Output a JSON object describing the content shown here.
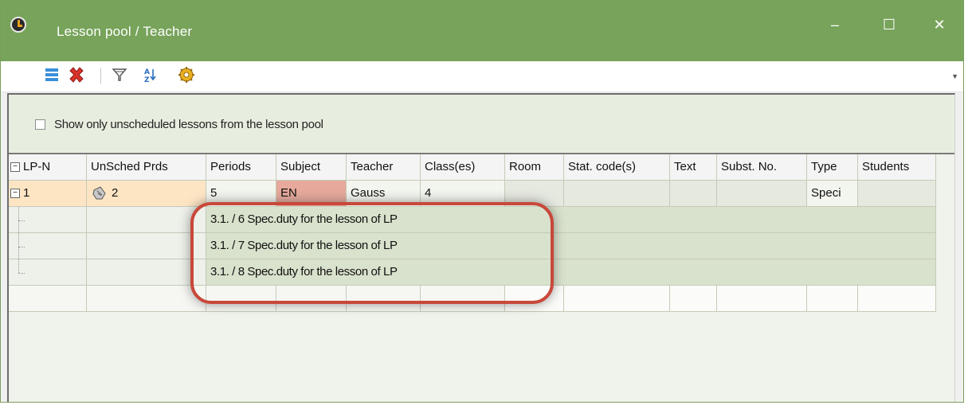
{
  "window": {
    "title": "Lesson pool / Teacher",
    "controls": {
      "minimize": "‒",
      "maximize": "☐",
      "close": "✕"
    }
  },
  "toolbar": {
    "icons": [
      "list-icon",
      "delete-icon",
      "filter-icon",
      "sort-icon",
      "settings-icon"
    ]
  },
  "option": {
    "label": "Show only unscheduled lessons from the lesson pool",
    "checked": false
  },
  "grid": {
    "headers": [
      "LP-Nr",
      "UnSched Prds",
      "Periods",
      "Subject",
      "Teacher",
      "Class(es)",
      "Room",
      "Stat. code(s)",
      "Text",
      "Subst. No.",
      "Type",
      "Students"
    ],
    "header_display_first": "LP-N",
    "lesson": {
      "lp": "1",
      "unsched": "2",
      "periods": "5",
      "subject": "EN",
      "teacher": "Gauss",
      "classes": "4",
      "room": "",
      "stat": "",
      "text": "",
      "subst": "",
      "type": "Speci",
      "students": ""
    },
    "duties": [
      "3.1. / 6 Spec.duty for the lesson of LP",
      "3.1. / 7 Spec.duty for the lesson of LP",
      "3.1. / 8 Spec.duty for the lesson of LP"
    ]
  },
  "colors": {
    "titlebar": "#77a35a",
    "highlight": "#c8483a",
    "subject": "#e6a99c",
    "lp_cell": "#fde5c4"
  }
}
